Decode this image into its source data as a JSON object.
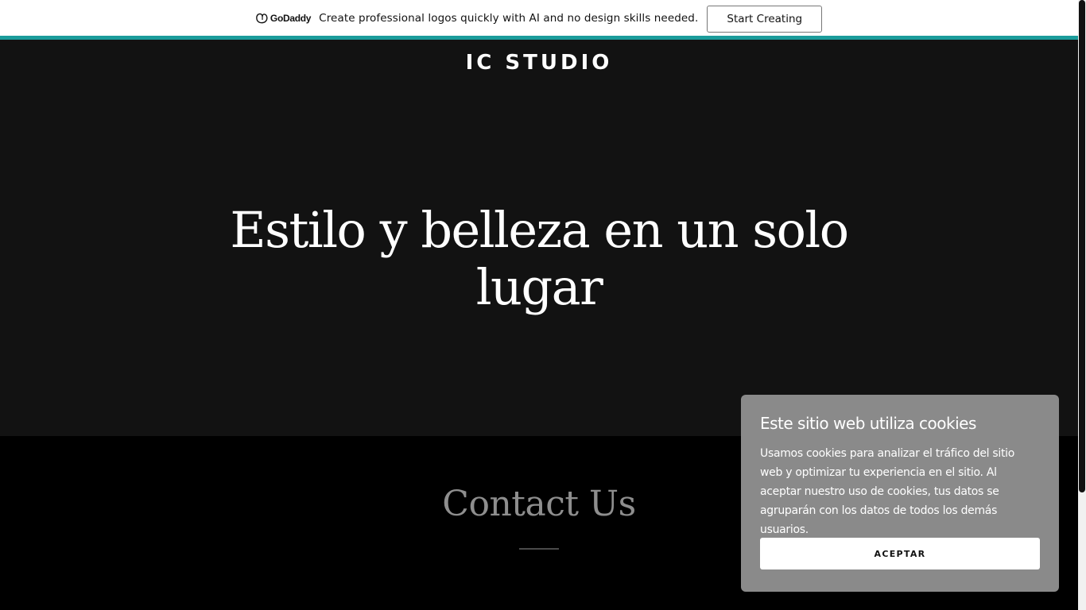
{
  "promo_bar": {
    "logo_text": "GoDaddy",
    "message": "Create professional logos quickly with AI and no design skills needed.",
    "cta_label": "Start Creating",
    "accent_color": "#1b9c9b"
  },
  "header": {
    "site_title": "IC STUDIO"
  },
  "hero": {
    "heading": "Estilo y belleza en un solo lugar"
  },
  "contact": {
    "heading": "Contact Us"
  },
  "cookie_banner": {
    "title": "Este sitio web utiliza cookies",
    "body": "Usamos cookies para analizar el tráfico del sitio web y optimizar tu experiencia en el sitio. Al aceptar nuestro uso de cookies, tus datos se agruparán con los datos de todos los demás usuarios.",
    "accept_label": "ACEPTAR"
  }
}
